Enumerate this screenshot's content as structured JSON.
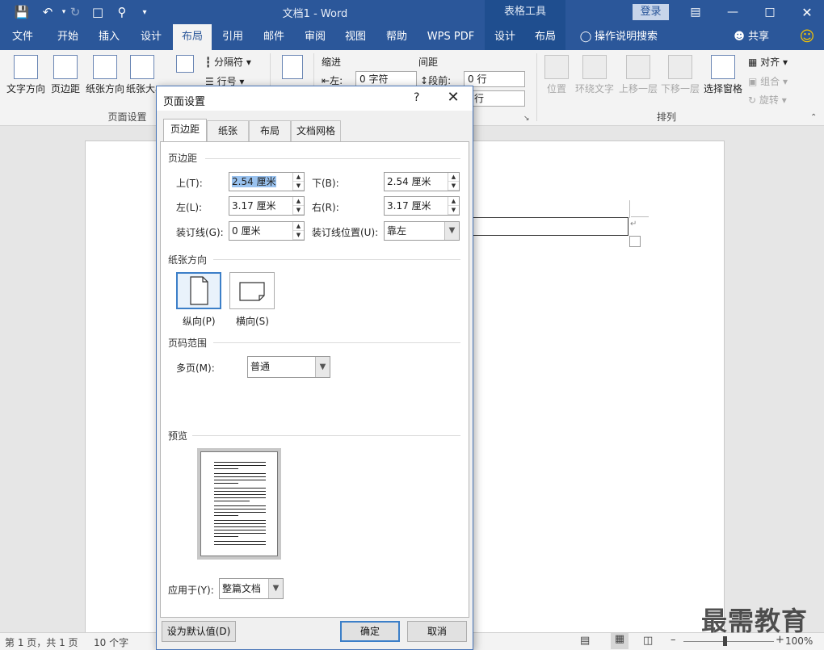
{
  "window": {
    "title": "文档1  -  Word",
    "context_header": "表格工具",
    "login": "登录"
  },
  "tabs": [
    "文件",
    "开始",
    "插入",
    "设计",
    "布局",
    "引用",
    "邮件",
    "审阅",
    "视图",
    "帮助",
    "WPS PDF",
    "设计",
    "布局"
  ],
  "active_tab": "布局",
  "tell_me": "操作说明搜索",
  "share": "共享",
  "ribbon": {
    "page_setup": {
      "buttons": [
        "文字方向",
        "页边距",
        "纸张方向",
        "纸张大小",
        "栏"
      ],
      "separator_label": "分隔符",
      "line_num_label": "行号",
      "group_label": "页面设置"
    },
    "paragraph": {
      "indent_label": "缩进",
      "spacing_label": "间距",
      "left_label": "左:",
      "left_value": "0 字符",
      "before_label": "段前:",
      "before_value": "0 行",
      "after_value": "行",
      "button_label": "稿纸"
    },
    "arrange": {
      "buttons": [
        "位置",
        "环绕文字",
        "上移一层",
        "下移一层",
        "选择窗格"
      ],
      "align": "对齐",
      "group": "组合",
      "rotate": "旋转",
      "group_label": "排列"
    }
  },
  "dialog": {
    "title": "页面设置",
    "help": "?",
    "tabs": [
      "页边距",
      "纸张",
      "布局",
      "文档网格"
    ],
    "margins_section": "页边距",
    "top_label": "上(T):",
    "top_value": "2.54 厘米",
    "bottom_label": "下(B):",
    "bottom_value": "2.54 厘米",
    "left_label": "左(L):",
    "left_value": "3.17 厘米",
    "right_label": "右(R):",
    "right_value": "3.17 厘米",
    "gutter_label": "装订线(G):",
    "gutter_value": "0 厘米",
    "gutter_pos_label": "装订线位置(U):",
    "gutter_pos_value": "靠左",
    "orientation_section": "纸张方向",
    "portrait_label": "纵向(P)",
    "landscape_label": "横向(S)",
    "pages_section": "页码范围",
    "multiple_pages_label": "多页(M):",
    "multiple_pages_value": "普通",
    "preview_section": "预览",
    "apply_to_label": "应用于(Y):",
    "apply_to_value": "整篇文档",
    "default_button": "设为默认值(D)",
    "ok_button": "确定",
    "cancel_button": "取消"
  },
  "status": {
    "page": "第 1 页，共 1 页",
    "words": "10 个字",
    "zoom": "100%"
  },
  "watermark": "最需教育"
}
